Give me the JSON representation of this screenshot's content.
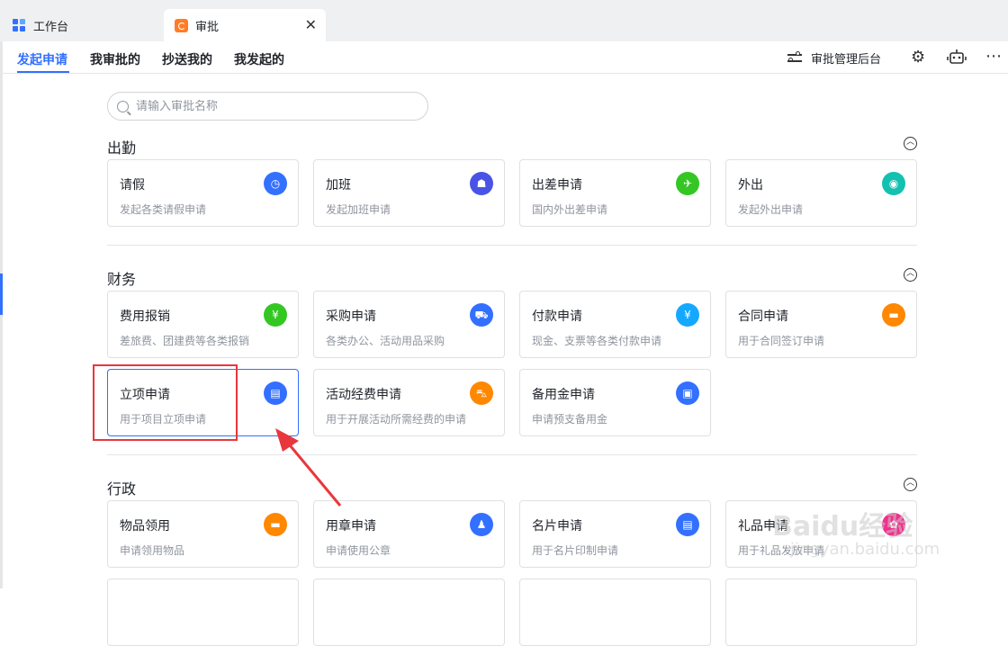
{
  "tabs": {
    "workbench": "工作台",
    "approval": "审批",
    "close": "✕"
  },
  "nav": {
    "items": [
      "发起申请",
      "我审批的",
      "抄送我的",
      "我发起的"
    ],
    "admin": "审批管理后台",
    "settings_icon": "⚙",
    "bot_icon": "robot-icon",
    "more_icon": "⋯"
  },
  "search": {
    "placeholder": "请输入审批名称"
  },
  "sections": [
    {
      "title": "出勤",
      "cards": [
        {
          "title": "请假",
          "desc": "发起各类请假申请",
          "icon": "clock-icon",
          "glyph": "◷",
          "color": "#3370ff"
        },
        {
          "title": "加班",
          "desc": "发起加班申请",
          "icon": "lamp-icon",
          "glyph": "☗",
          "color": "#4954e6"
        },
        {
          "title": "出差申请",
          "desc": "国内外出差申请",
          "icon": "plane-icon",
          "glyph": "✈",
          "color": "#34c724"
        },
        {
          "title": "外出",
          "desc": "发起外出申请",
          "icon": "location-icon",
          "glyph": "◉",
          "color": "#14c0b0"
        }
      ]
    },
    {
      "title": "财务",
      "cards": [
        {
          "title": "费用报销",
          "desc": "差旅费、团建费等各类报销",
          "icon": "money-icon",
          "glyph": "¥",
          "color": "#34c724"
        },
        {
          "title": "采购申请",
          "desc": "各类办公、活动用品采购",
          "icon": "cart-icon",
          "glyph": "⛟",
          "color": "#3370ff"
        },
        {
          "title": "付款申请",
          "desc": "现金、支票等各类付款申请",
          "icon": "yen-icon",
          "glyph": "¥",
          "color": "#14a9ff"
        },
        {
          "title": "合同申请",
          "desc": "用于合同签订申请",
          "icon": "briefcase-icon",
          "glyph": "▬",
          "color": "#ff8800"
        },
        {
          "title": "立项申请",
          "desc": "用于项目立项申请",
          "icon": "document-icon",
          "glyph": "▤",
          "color": "#3370ff"
        },
        {
          "title": "活动经费申请",
          "desc": "用于开展活动所需经费的申请",
          "icon": "car-icon",
          "glyph": "⛍",
          "color": "#ff8800"
        },
        {
          "title": "备用金申请",
          "desc": "申请预支备用金",
          "icon": "wallet-icon",
          "glyph": "▣",
          "color": "#3370ff"
        }
      ]
    },
    {
      "title": "行政",
      "cards": [
        {
          "title": "物品领用",
          "desc": "申请领用物品",
          "icon": "box-icon",
          "glyph": "▬",
          "color": "#ff8800"
        },
        {
          "title": "用章申请",
          "desc": "申请使用公章",
          "icon": "stamp-icon",
          "glyph": "♟",
          "color": "#3370ff"
        },
        {
          "title": "名片申请",
          "desc": "用于名片印制申请",
          "icon": "card-icon",
          "glyph": "▤",
          "color": "#3370ff"
        },
        {
          "title": "礼品申请",
          "desc": "用于礼品发放申请",
          "icon": "gift-icon",
          "glyph": "✿",
          "color": "#f0308e"
        }
      ]
    }
  ],
  "watermark": {
    "brand": "Baidu经验",
    "url": "jingyan.baidu.com"
  },
  "colors": {
    "accent": "#3370ff",
    "highlight": "#e8373c"
  }
}
